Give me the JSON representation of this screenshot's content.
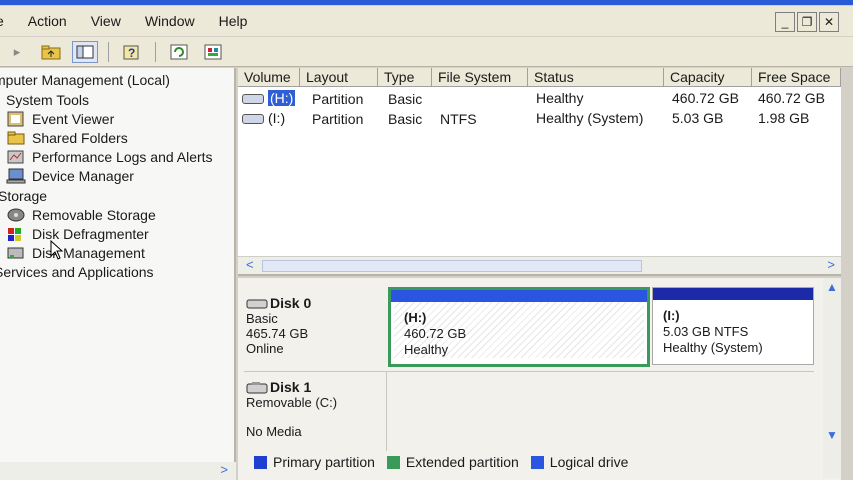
{
  "menu": [
    "e",
    "Action",
    "View",
    "Window",
    "Help"
  ],
  "tree": [
    {
      "label": "mputer Management (Local)",
      "icon": "computer-management-icon"
    },
    {
      "label": "System Tools",
      "icon": "tools-icon"
    },
    {
      "label": "Event Viewer",
      "icon": "event-viewer-icon"
    },
    {
      "label": "Shared Folders",
      "icon": "shared-folder-icon"
    },
    {
      "label": "Performance Logs and Alerts",
      "icon": "performance-icon"
    },
    {
      "label": "Device Manager",
      "icon": "device-manager-icon"
    },
    {
      "label": "Storage",
      "icon": "storage-icon"
    },
    {
      "label": "Removable Storage",
      "icon": "removable-storage-icon"
    },
    {
      "label": "Disk Defragmenter",
      "icon": "defragmenter-icon"
    },
    {
      "label": "Disk Management",
      "icon": "disk-management-icon"
    },
    {
      "label": "Services and Applications",
      "icon": "services-icon"
    }
  ],
  "columns": [
    "Volume",
    "Layout",
    "Type",
    "File System",
    "Status",
    "Capacity",
    "Free Space"
  ],
  "volumes": [
    {
      "volume": "(H:)",
      "layout": "Partition",
      "type": "Basic",
      "fs": "",
      "status": "Healthy",
      "capacity": "460.72 GB",
      "free": "460.72 GB"
    },
    {
      "volume": "(I:)",
      "layout": "Partition",
      "type": "Basic",
      "fs": "NTFS",
      "status": "Healthy (System)",
      "capacity": "5.03 GB",
      "free": "1.98 GB"
    }
  ],
  "disks": [
    {
      "name": "Disk 0",
      "type": "Basic",
      "size": "465.74 GB",
      "state": "Online"
    },
    {
      "name": "Disk 1",
      "type": "Removable (C:)",
      "media": "No Media"
    }
  ],
  "partitions": [
    {
      "label": "(H:)",
      "size": "460.72 GB",
      "status": "Healthy"
    },
    {
      "label": "(I:)",
      "size": "5.03 GB NTFS",
      "status": "Healthy (System)"
    }
  ],
  "legend": [
    {
      "label": "Primary partition",
      "color": "#1f3fd0"
    },
    {
      "label": "Extended partition",
      "color": "#3a9a5a"
    },
    {
      "label": "Logical drive",
      "color": "#2a55e0"
    }
  ],
  "colors": {
    "selection": "#2f5fd4",
    "primary_bar": "#1c2aa8",
    "logical_bar": "#3060e0",
    "extended_border": "#3a9a5a"
  }
}
